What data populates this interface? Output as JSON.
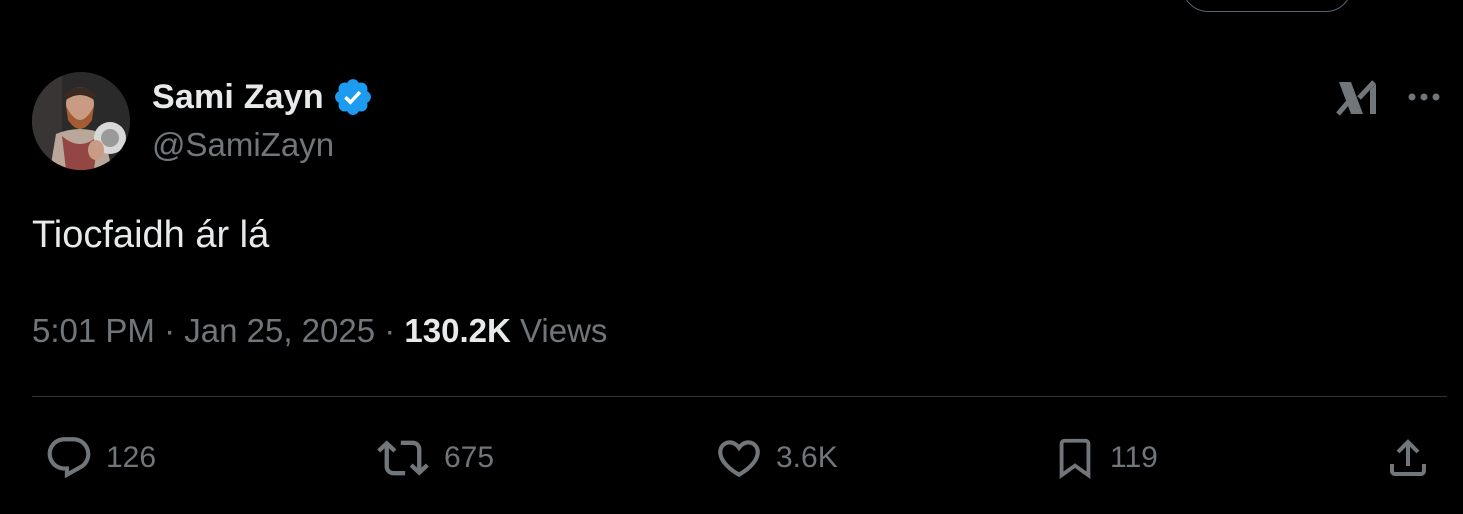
{
  "author": {
    "display_name": "Sami Zayn",
    "handle": "@SamiZayn",
    "verified": true
  },
  "icons": {
    "verified": "verified-badge-icon",
    "grok": "grok-icon",
    "more": "more-options-icon",
    "reply": "reply-icon",
    "repost": "repost-icon",
    "like": "heart-icon",
    "bookmark": "bookmark-icon",
    "share": "share-icon"
  },
  "tweet": {
    "text": "Tiocfaidh ár lá",
    "time": "5:01 PM",
    "separator": " · ",
    "date": "Jan 25, 2025",
    "views_count": "130.2K",
    "views_label": " Views"
  },
  "actions": {
    "replies": "126",
    "reposts": "675",
    "likes": "3.6K",
    "bookmarks": "119"
  },
  "colors": {
    "background": "#000000",
    "primary_text": "#e7e9ea",
    "secondary_text": "#71767b",
    "verified_blue": "#1d9bf0",
    "divider": "#2f3336"
  }
}
